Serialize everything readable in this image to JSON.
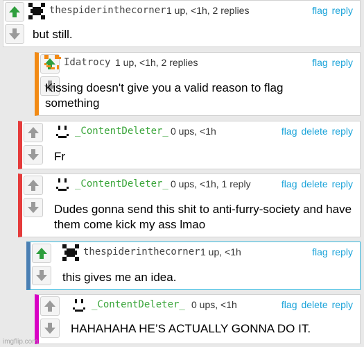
{
  "colors": {
    "upvote": "#2e9e3d",
    "downvote": "#9a9a9a",
    "link": "#1aa3d9",
    "green_name": "#3aa53a",
    "bar_orange": "#f28a14",
    "bar_red": "#e53b3b",
    "bar_blue": "#4a7fb3",
    "bar_magenta": "#d800c4"
  },
  "icons": {
    "upvote": "up-arrow-icon",
    "downvote": "down-arrow-icon"
  },
  "labels": {
    "flag": "flag",
    "delete": "delete",
    "reply": "reply"
  },
  "watermark": "imgflip.com",
  "comments": [
    {
      "username": "thespiderinthecorner",
      "meta": "1 up, <1h, 2 replies",
      "text": "but still.",
      "upvoted": true,
      "accent": "none",
      "has_delete": false
    },
    {
      "username": "Idatrocy",
      "meta": "1 up, <1h, 2 replies",
      "text": "Kissing doesn't give you a valid reason to flag something",
      "upvoted": true,
      "accent": "orange",
      "has_delete": false
    },
    {
      "username": "_ContentDeleter_",
      "meta": "0 ups, <1h",
      "text": "Fr",
      "upvoted": false,
      "accent": "red",
      "has_delete": true
    },
    {
      "username": "_ContentDeleter_",
      "meta": "0 ups, <1h, 1 reply",
      "text": "Dudes gonna send this shit to anti-furry-society and have them come kick my ass lmao",
      "upvoted": false,
      "accent": "red",
      "has_delete": true
    },
    {
      "username": "thespiderinthecorner",
      "meta": "1 up, <1h",
      "text": "this gives me an idea.",
      "upvoted": true,
      "accent": "blue",
      "has_delete": false
    },
    {
      "username": "_ContentDeleter_",
      "meta": "0 ups, <1h",
      "text": "HAHAHAHA HE’S ACTUALLY GONNA DO IT.",
      "upvoted": false,
      "accent": "magenta",
      "has_delete": true
    }
  ]
}
